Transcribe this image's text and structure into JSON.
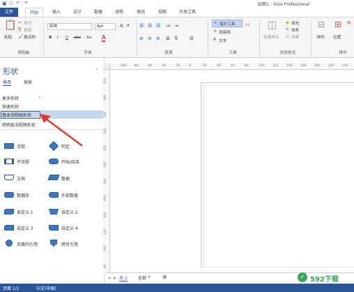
{
  "title": {
    "text": "绘图1 - Visio Professional",
    "min": "—"
  },
  "tabs": [
    "文件",
    "开始",
    "插入",
    "设计",
    "数据",
    "进程",
    "审阅",
    "视图",
    "开发工具"
  ],
  "ribbon": {
    "clipboard": {
      "paste": "粘贴",
      "cut": "剪切",
      "copy": "复制",
      "format_painter": "格式刷",
      "label": "剪贴板"
    },
    "font": {
      "name": "宋体",
      "size": "8pt",
      "bold": "B",
      "italic": "I",
      "underline": "U",
      "strike": "abc",
      "aa_label": "Aa",
      "color_a": "A",
      "grow": "A",
      "shrink": "A",
      "label": "字体"
    },
    "paragraph": {
      "label": "段落"
    },
    "tools": {
      "pointer": "指针工具",
      "connector": "连接线",
      "text": "文本",
      "label": "工具"
    },
    "shape_style": {
      "quick_styles": "快速样式",
      "fill": "填充",
      "line": "线条",
      "effects": "效果",
      "label": "形状样式"
    },
    "arrange": {
      "align": "排列",
      "position": "位置",
      "label": "排列"
    }
  },
  "shapes_panel": {
    "title": "形状",
    "tab_stencils": "模具",
    "tab_search": "搜索",
    "nav": [
      "更多形状",
      "快速形状",
      "基本流程图形状",
      "跨职能流程图形状"
    ],
    "items": [
      [
        "流程",
        "判定"
      ],
      [
        "子流程",
        "开始/结束"
      ],
      [
        "文档",
        "数据"
      ],
      [
        "数据库",
        "外部数据"
      ],
      [
        "自定义 1",
        "自定义 2"
      ],
      [
        "自定义 3",
        "自定义 4"
      ],
      [
        "页面内引用",
        "跨页引用"
      ]
    ]
  },
  "ruler": {
    "h": [
      "-100",
      "-80",
      "-60",
      "-40",
      "-20",
      "0",
      "20",
      "40",
      "60",
      "80",
      "100",
      "120",
      "140",
      "160",
      "180",
      "200",
      "220"
    ],
    "v": [
      "300",
      "280",
      "260",
      "240",
      "220",
      "200",
      "180",
      "160",
      "140",
      "120",
      "100",
      "80"
    ]
  },
  "pagebar": {
    "page": "页-1",
    "all": "全部",
    "add": "⊕"
  },
  "status": {
    "page": "页面 1/1",
    "lang": "中文(中国)"
  },
  "watermark": {
    "text": "592下载"
  },
  "colors": {
    "accent": "#2b579a",
    "highlight": "#c5d7f0",
    "arrow": "#e03a2f",
    "shape": "#3a78c2"
  }
}
